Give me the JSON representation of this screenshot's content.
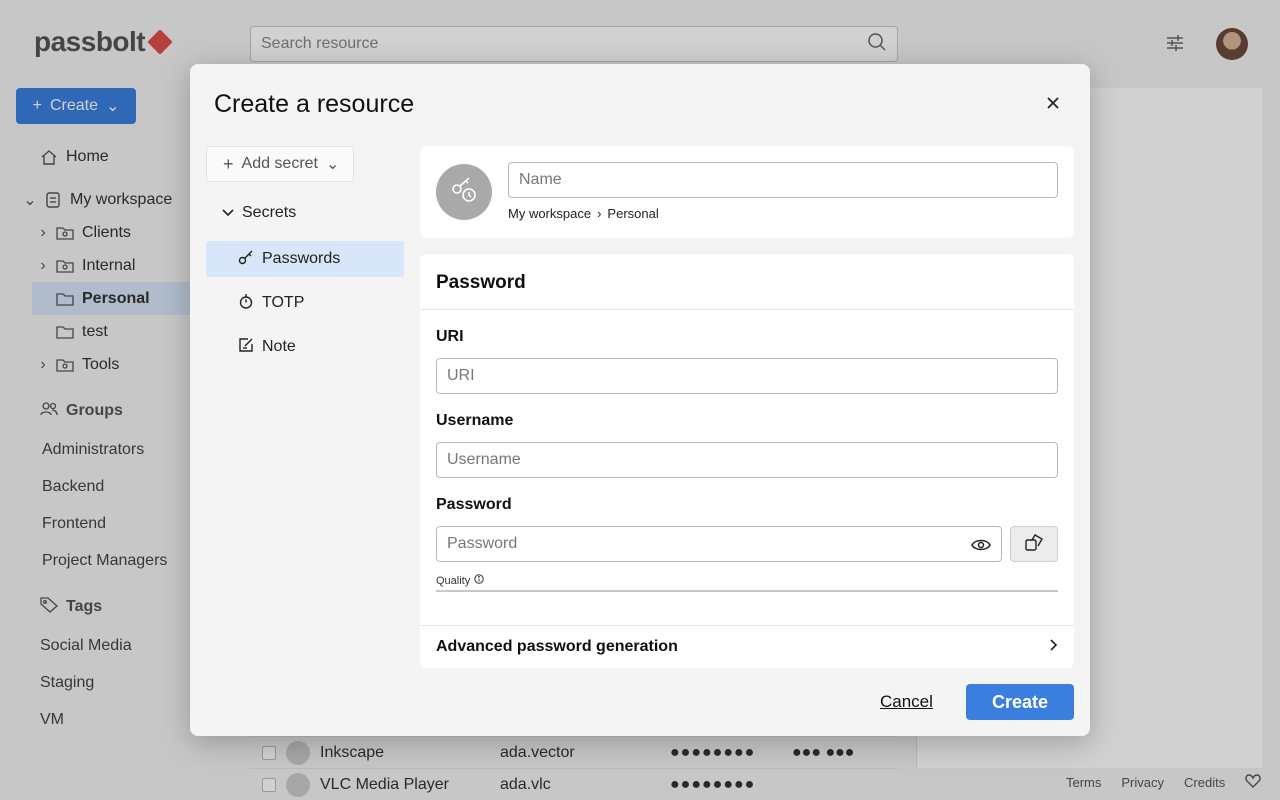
{
  "app": {
    "logo_text": "passbolt",
    "search_placeholder": "Search resource",
    "create_label": "Create",
    "nav": {
      "home": "Home",
      "my_workspace": "My workspace",
      "folders": [
        "Clients",
        "Internal",
        "Personal",
        "test",
        "Tools"
      ],
      "groups_heading": "Groups",
      "groups": [
        "Administrators",
        "Backend",
        "Frontend",
        "Project Managers"
      ],
      "tags_heading": "Tags",
      "tags": [
        "Social Media",
        "Staging",
        "VM"
      ]
    },
    "table_rows": [
      {
        "name": "Inkscape",
        "username": "ada.vector",
        "password": "●●●●●●●●",
        "totp": "●●● ●●●"
      },
      {
        "name": "VLC Media Player",
        "username": "ada.vlc",
        "password": "●●●●●●●●",
        "totp": ""
      }
    ],
    "footer": [
      "Terms",
      "Privacy",
      "Credits"
    ]
  },
  "dialog": {
    "title": "Create a resource",
    "add_secret_label": "Add secret",
    "secrets_heading": "Secrets",
    "secret_types": [
      "Passwords",
      "TOTP",
      "Note"
    ],
    "name_placeholder": "Name",
    "breadcrumb": {
      "root": "My workspace",
      "separator": "›",
      "folder": "Personal"
    },
    "section_title": "Password",
    "uri_label": "URI",
    "uri_placeholder": "URI",
    "username_label": "Username",
    "username_placeholder": "Username",
    "password_label": "Password",
    "password_placeholder": "Password",
    "quality_label": "Quality",
    "advanced_label": "Advanced password generation",
    "cancel_label": "Cancel",
    "create_label": "Create"
  },
  "colors": {
    "primary": "#3a7fde",
    "selected": "#d7e6f8",
    "danger_mark": "#e34b4b"
  }
}
